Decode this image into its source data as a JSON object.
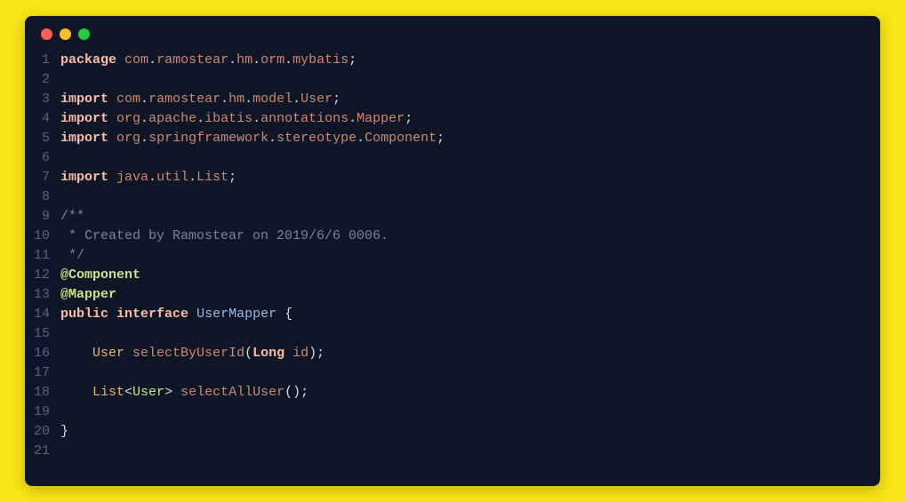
{
  "window": {
    "traffic_lights": [
      "red",
      "yellow",
      "green"
    ]
  },
  "code": {
    "lines": [
      {
        "n": 1,
        "tokens": [
          [
            "kw",
            "package"
          ],
          [
            "sp",
            " "
          ],
          [
            "pkg",
            "com"
          ],
          [
            "punc",
            "."
          ],
          [
            "pkg",
            "ramostear"
          ],
          [
            "punc",
            "."
          ],
          [
            "pkg",
            "hm"
          ],
          [
            "punc",
            "."
          ],
          [
            "pkg",
            "orm"
          ],
          [
            "punc",
            "."
          ],
          [
            "pkg",
            "mybatis"
          ],
          [
            "punc",
            ";"
          ]
        ]
      },
      {
        "n": 2,
        "tokens": []
      },
      {
        "n": 3,
        "tokens": [
          [
            "kw",
            "import"
          ],
          [
            "sp",
            " "
          ],
          [
            "pkg",
            "com"
          ],
          [
            "punc",
            "."
          ],
          [
            "pkg",
            "ramostear"
          ],
          [
            "punc",
            "."
          ],
          [
            "pkg",
            "hm"
          ],
          [
            "punc",
            "."
          ],
          [
            "pkg",
            "model"
          ],
          [
            "punc",
            "."
          ],
          [
            "pkg",
            "User"
          ],
          [
            "punc",
            ";"
          ]
        ]
      },
      {
        "n": 4,
        "tokens": [
          [
            "kw",
            "import"
          ],
          [
            "sp",
            " "
          ],
          [
            "pkg",
            "org"
          ],
          [
            "punc",
            "."
          ],
          [
            "pkg",
            "apache"
          ],
          [
            "punc",
            "."
          ],
          [
            "pkg",
            "ibatis"
          ],
          [
            "punc",
            "."
          ],
          [
            "pkg",
            "annotations"
          ],
          [
            "punc",
            "."
          ],
          [
            "pkg",
            "Mapper"
          ],
          [
            "punc",
            ";"
          ]
        ]
      },
      {
        "n": 5,
        "tokens": [
          [
            "kw",
            "import"
          ],
          [
            "sp",
            " "
          ],
          [
            "pkg",
            "org"
          ],
          [
            "punc",
            "."
          ],
          [
            "pkg",
            "springframework"
          ],
          [
            "punc",
            "."
          ],
          [
            "pkg",
            "stereotype"
          ],
          [
            "punc",
            "."
          ],
          [
            "pkg",
            "Component"
          ],
          [
            "punc",
            ";"
          ]
        ]
      },
      {
        "n": 6,
        "tokens": []
      },
      {
        "n": 7,
        "tokens": [
          [
            "kw",
            "import"
          ],
          [
            "sp",
            " "
          ],
          [
            "pkg",
            "java"
          ],
          [
            "punc",
            "."
          ],
          [
            "pkg",
            "util"
          ],
          [
            "punc",
            "."
          ],
          [
            "pkg",
            "List"
          ],
          [
            "punc",
            ";"
          ]
        ]
      },
      {
        "n": 8,
        "tokens": []
      },
      {
        "n": 9,
        "tokens": [
          [
            "comment",
            "/**"
          ]
        ]
      },
      {
        "n": 10,
        "tokens": [
          [
            "comment",
            " * Created by Ramostear on 2019/6/6 0006."
          ]
        ]
      },
      {
        "n": 11,
        "tokens": [
          [
            "comment",
            " */"
          ]
        ]
      },
      {
        "n": 12,
        "tokens": [
          [
            "ann",
            "@Component"
          ]
        ]
      },
      {
        "n": 13,
        "tokens": [
          [
            "ann",
            "@Mapper"
          ]
        ]
      },
      {
        "n": 14,
        "tokens": [
          [
            "kw",
            "public"
          ],
          [
            "sp",
            " "
          ],
          [
            "kw",
            "interface"
          ],
          [
            "sp",
            " "
          ],
          [
            "class",
            "UserMapper"
          ],
          [
            "sp",
            " "
          ],
          [
            "punc",
            "{"
          ]
        ]
      },
      {
        "n": 15,
        "tokens": []
      },
      {
        "n": 16,
        "tokens": [
          [
            "sp",
            "    "
          ],
          [
            "type",
            "User"
          ],
          [
            "sp",
            " "
          ],
          [
            "pkg",
            "selectByUserId"
          ],
          [
            "punc",
            "("
          ],
          [
            "kw",
            "Long"
          ],
          [
            "sp",
            " "
          ],
          [
            "pkg",
            "id"
          ],
          [
            "punc",
            ")"
          ],
          [
            "punc",
            ";"
          ]
        ]
      },
      {
        "n": 17,
        "tokens": []
      },
      {
        "n": 18,
        "tokens": [
          [
            "sp",
            "    "
          ],
          [
            "type",
            "List"
          ],
          [
            "punc",
            "<"
          ],
          [
            "generic",
            "User"
          ],
          [
            "punc",
            ">"
          ],
          [
            "sp",
            " "
          ],
          [
            "pkg",
            "selectAllUser"
          ],
          [
            "punc",
            "()"
          ],
          [
            "punc",
            ";"
          ]
        ]
      },
      {
        "n": 19,
        "tokens": []
      },
      {
        "n": 20,
        "tokens": [
          [
            "punc",
            "}"
          ]
        ]
      },
      {
        "n": 21,
        "tokens": []
      }
    ]
  }
}
